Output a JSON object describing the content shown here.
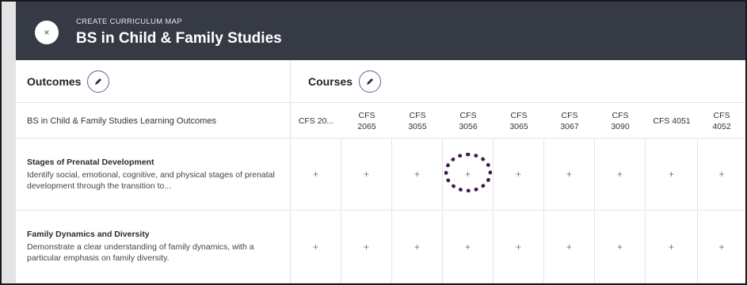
{
  "header": {
    "subtitle": "CREATE CURRICULUM MAP",
    "title": "BS in Child & Family Studies",
    "close_icon": "×"
  },
  "sections": {
    "outcomes_label": "Outcomes",
    "courses_label": "Courses"
  },
  "outcomes_header": "BS in Child & Family Studies Learning Outcomes",
  "courses": [
    {
      "line1": "CFS 20...",
      "line2": ""
    },
    {
      "line1": "CFS",
      "line2": "2065"
    },
    {
      "line1": "CFS",
      "line2": "3055"
    },
    {
      "line1": "CFS",
      "line2": "3056"
    },
    {
      "line1": "CFS",
      "line2": "3065"
    },
    {
      "line1": "CFS",
      "line2": "3067"
    },
    {
      "line1": "CFS",
      "line2": "3090"
    },
    {
      "line1": "CFS 4051",
      "line2": ""
    },
    {
      "line1": "CFS",
      "line2": "4052"
    }
  ],
  "outcomes": [
    {
      "title": "Stages of Prenatal Development",
      "description": "Identify social, emotional, cognitive, and physical stages of prenatal development through the transition to..."
    },
    {
      "title": "Family Dynamics and Diversity",
      "description": "Demonstrate a clear understanding of family dynamics, with a particular emphasis on family diversity."
    }
  ],
  "cell_symbol": "+",
  "colors": {
    "header_bg": "#363a45",
    "accent": "#6b5a9e",
    "highlight_ring": "#3d1a4f"
  }
}
